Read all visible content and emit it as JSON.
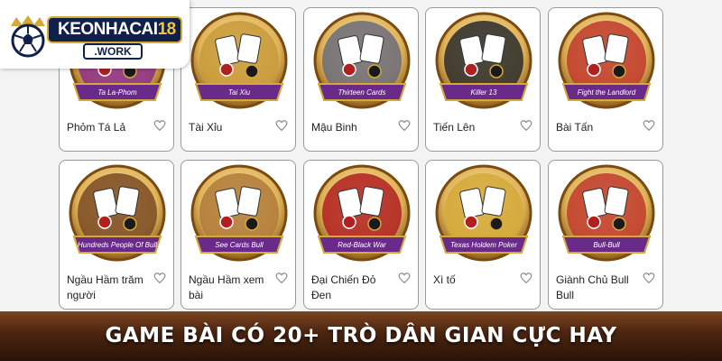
{
  "logo": {
    "brand": "KEONHACAI",
    "brand_number": "18",
    "domain": ".WORK"
  },
  "games": [
    {
      "name": "Phỏm Tá Lả",
      "banner": "Ta La-Phom",
      "icon": "cards-chips-icon",
      "color": "#8a2d8a"
    },
    {
      "name": "Tài Xỉu",
      "banner": "Tai Xiu",
      "icon": "dice-cup-icon",
      "color": "#c89a3a"
    },
    {
      "name": "Mậu Binh",
      "banner": "Thirteen Cards",
      "icon": "revolver-cards-icon",
      "color": "#6b6b7a"
    },
    {
      "name": "Tiến Lên",
      "banner": "Killer 13",
      "icon": "bomb-icon",
      "color": "#2a2a2a"
    },
    {
      "name": "Bài Tấn",
      "banner": "Fight the Landlord",
      "icon": "landlord-character-icon",
      "color": "#c0392b"
    },
    {
      "name": "Ngầu Hầm trăm người",
      "banner": "Hundreds People Of Bull",
      "icon": "bull-crowd-icon",
      "color": "#7a4a22"
    },
    {
      "name": "Ngầu Hầm xem bài",
      "banner": "See Cards Bull",
      "icon": "bull-mascot-icon",
      "color": "#b07a3a"
    },
    {
      "name": "Đại Chiến Đỏ Đen",
      "banner": "Red-Black War",
      "icon": "versus-cards-icon",
      "color": "#b02020"
    },
    {
      "name": "Xì tố",
      "banner": "Texas Holdem Poker",
      "icon": "crown-cards-icon",
      "color": "#d4a93a"
    },
    {
      "name": "Giành Chủ Bull Bull",
      "banner": "Bull-Bull",
      "icon": "bull-head-icon",
      "color": "#c0392b"
    }
  ],
  "footer": {
    "headline": "GAME BÀI CÓ 20+ TRÒ DÂN GIAN CỰC HAY"
  }
}
